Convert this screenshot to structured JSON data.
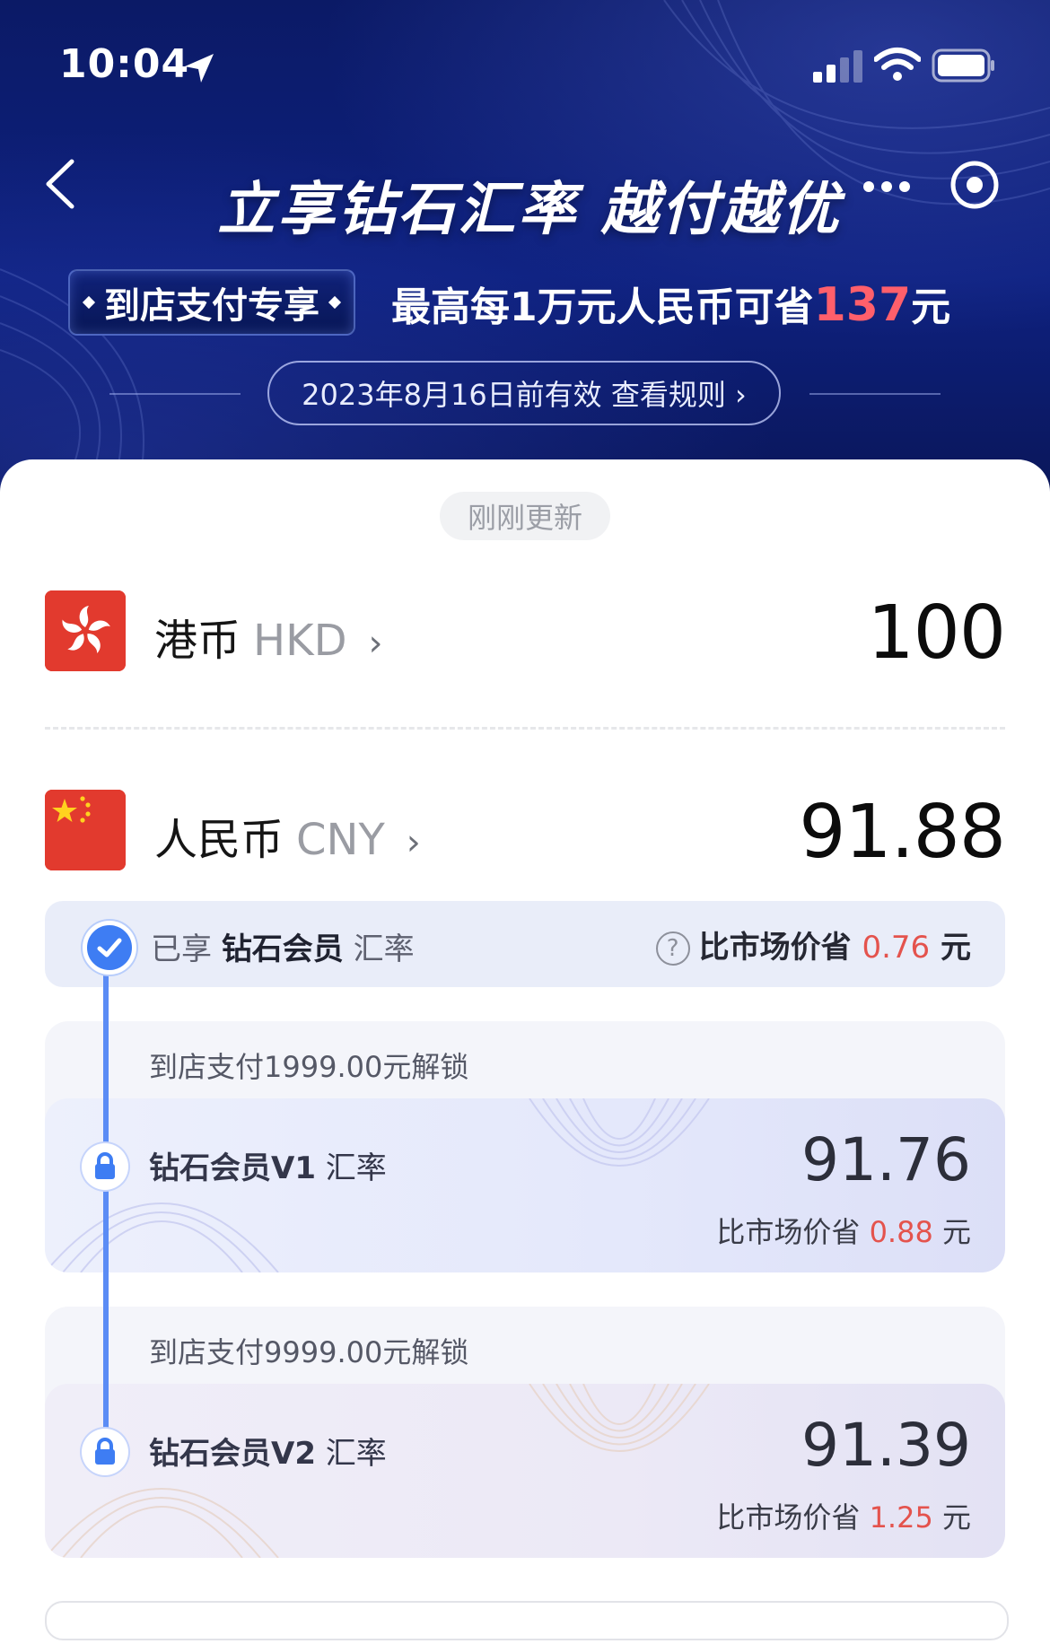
{
  "status_bar": {
    "time": "10:04"
  },
  "header": {
    "title": "立享钻石汇率 越付越优",
    "badge": "到店支付专享",
    "promo_prefix": "最高每1万元人民币可省",
    "promo_amount": "137",
    "promo_suffix": "元",
    "rule_text": "2023年8月16日前有效 查看规则 ›"
  },
  "converter": {
    "updated_label": "刚刚更新",
    "from": {
      "name": "港币",
      "code": "HKD",
      "amount": "100"
    },
    "to": {
      "name": "人民币",
      "code": "CNY",
      "amount": "91.88"
    }
  },
  "tiers": {
    "current": {
      "prefix": "已享",
      "name": "钻石会员",
      "suffix": "汇率",
      "save_label": "比市场价省",
      "save_amount": "0.76",
      "unit": "元"
    },
    "levels": [
      {
        "unlock": "到店支付1999.00元解锁",
        "name": "钻石会员V1",
        "suffix": "汇率",
        "rate": "91.76",
        "save_label": "比市场价省",
        "save_amount": "0.88",
        "unit": "元"
      },
      {
        "unlock": "到店支付9999.00元解锁",
        "name": "钻石会员V2",
        "suffix": "汇率",
        "rate": "91.39",
        "save_label": "比市场价省",
        "save_amount": "1.25",
        "unit": "元"
      }
    ]
  },
  "colors": {
    "hero_bg": "#0e2180",
    "accent_red": "#e4534d",
    "timeline_blue": "#3e7df3",
    "flag_red": "#e23a2e"
  },
  "icons": [
    "location-arrow-icon",
    "signal-icon",
    "wifi-icon",
    "battery-icon",
    "back-icon",
    "more-icon",
    "target-icon",
    "hong-kong-flag-icon",
    "china-flag-icon",
    "chevron-right-icon",
    "check-icon",
    "lock-icon",
    "help-icon"
  ]
}
